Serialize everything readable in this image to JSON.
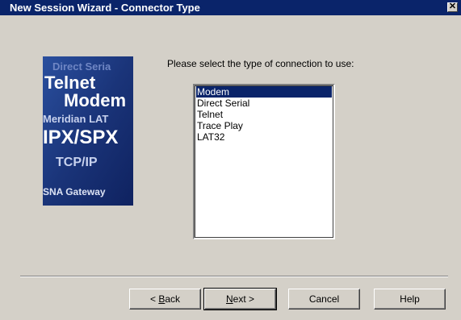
{
  "window": {
    "title": "New Session Wizard - Connector Type",
    "close_glyph": "✕"
  },
  "banner": {
    "words": [
      "Direct Seria",
      "Telnet",
      "Modem",
      "Meridian LAT",
      "IPX/SPX",
      "TCP/IP",
      "SNA Gateway"
    ]
  },
  "prompt": "Please select the type of connection to use:",
  "connection_list": {
    "items": [
      "Modem",
      "Direct Serial",
      "Telnet",
      "Trace Play",
      "LAT32"
    ],
    "selected_index": 0
  },
  "buttons": {
    "back_prefix": "< ",
    "back_accel": "B",
    "back_rest": "ack",
    "next_accel": "N",
    "next_rest": "ext >",
    "cancel": "Cancel",
    "help": "Help"
  },
  "colors": {
    "titlebar": "#0a246a",
    "dialog": "#d4d0c8",
    "banner": "#1c3a82",
    "selection": "#0a246a"
  }
}
